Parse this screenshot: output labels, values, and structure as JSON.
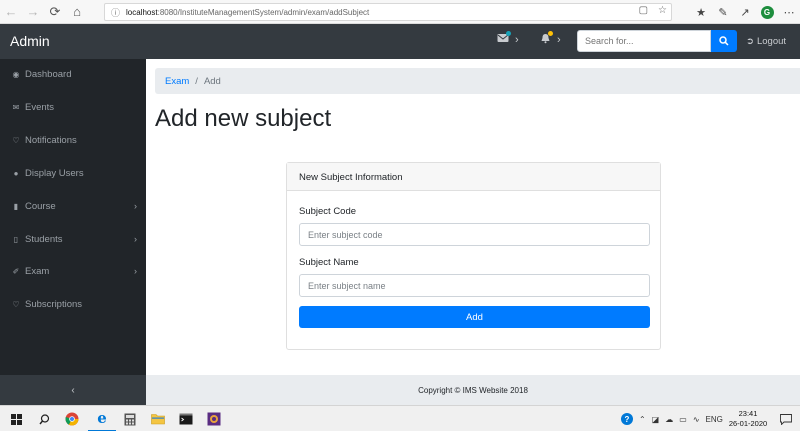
{
  "browser": {
    "url_host": "localhost",
    "url_path": ":8080/InstituteManagementSystem/admin/exam/addSubject"
  },
  "navbar": {
    "brand": "Admin",
    "search_placeholder": "Search for...",
    "logout_label": "Logout"
  },
  "sidebar": {
    "items": [
      {
        "label": "Dashboard",
        "icon": "dashboard-icon"
      },
      {
        "label": "Events",
        "icon": "envelope-icon"
      },
      {
        "label": "Notifications",
        "icon": "bell-icon"
      },
      {
        "label": "Display Users",
        "icon": "user-icon"
      },
      {
        "label": "Course",
        "icon": "book-icon",
        "expandable": true
      },
      {
        "label": "Students",
        "icon": "file-icon",
        "expandable": true
      },
      {
        "label": "Exam",
        "icon": "pencil-icon",
        "expandable": true
      },
      {
        "label": "Subscriptions",
        "icon": "bell-icon"
      }
    ]
  },
  "breadcrumb": {
    "parent": "Exam",
    "separator": "/",
    "current": "Add"
  },
  "page": {
    "title": "Add new subject"
  },
  "form": {
    "header": "New Subject Information",
    "subject_code_label": "Subject Code",
    "subject_code_placeholder": "Enter subject code",
    "subject_name_label": "Subject Name",
    "subject_name_placeholder": "Enter subject name",
    "submit_label": "Add"
  },
  "footer": {
    "text": "Copyright © IMS Website 2018"
  },
  "taskbar": {
    "language": "ENG",
    "time": "23:41",
    "date": "26-01-2020"
  },
  "colors": {
    "navbar_bg": "#343a40",
    "sidebar_bg": "#212529",
    "primary": "#007bff",
    "breadcrumb_bg": "#e9ecef"
  }
}
